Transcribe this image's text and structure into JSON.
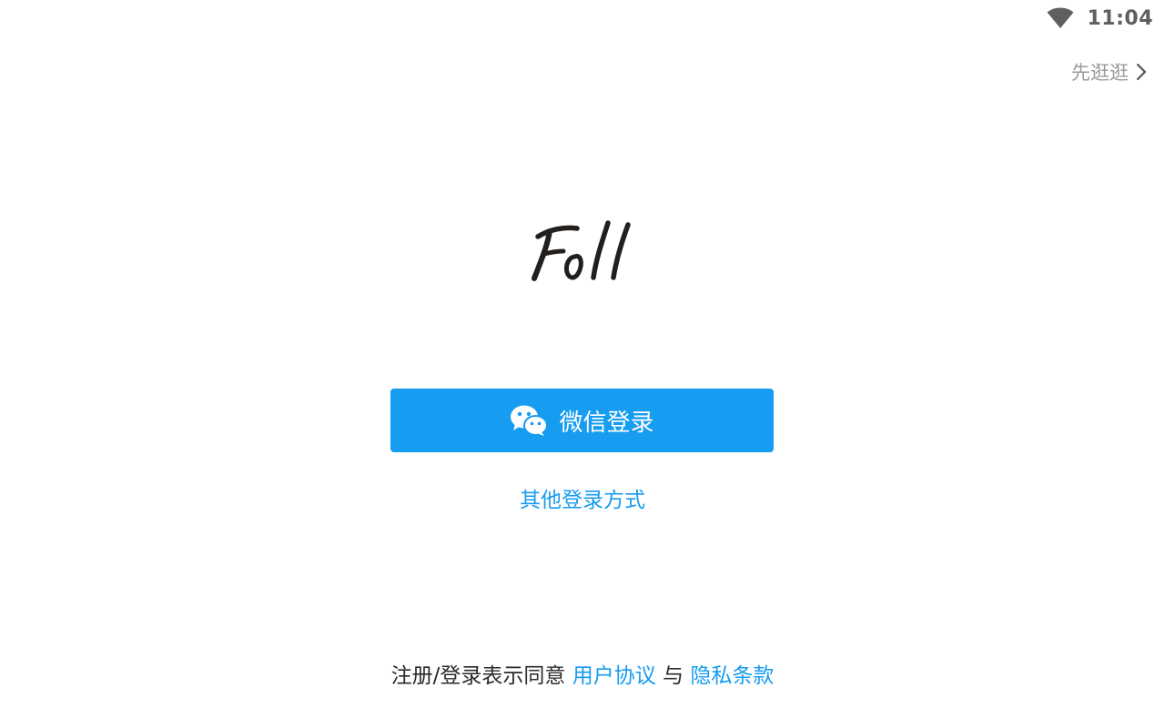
{
  "status_bar": {
    "time": "11:04",
    "wifi_icon": "wifi-icon"
  },
  "header": {
    "skip_label": "先逛逛",
    "skip_icon": "chevron-right-icon"
  },
  "logo": {
    "text": "Foll"
  },
  "login": {
    "wechat_label": "微信登录",
    "wechat_icon": "wechat-icon",
    "other_label": "其他登录方式"
  },
  "agreement": {
    "prefix": "注册/登录表示同意",
    "user_agreement": "用户协议",
    "conjunction": "与",
    "privacy_policy": "隐私条款"
  },
  "colors": {
    "accent": "#169cf0",
    "muted_text": "#9a9a9a",
    "body_text": "#2b2b2b",
    "background": "#ffffff"
  }
}
